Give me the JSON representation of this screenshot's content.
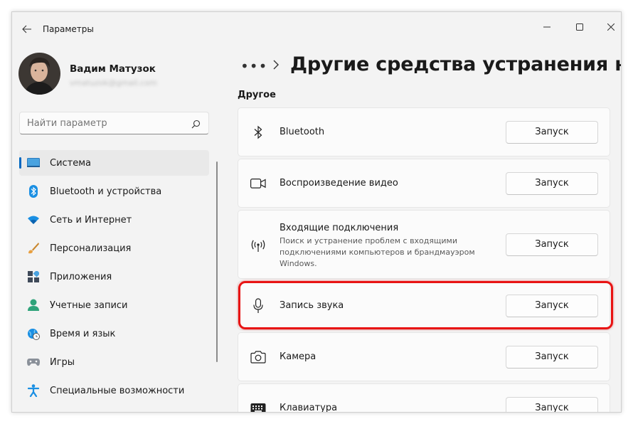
{
  "titlebar": {
    "app_title": "Параметры",
    "back_icon": "arrow-left-icon",
    "minimize_icon": "minimize-icon",
    "maximize_icon": "maximize-icon",
    "close_icon": "close-icon"
  },
  "profile": {
    "name": "Вадим Матузок",
    "email": "vmatuzok@gmail.com"
  },
  "search": {
    "placeholder": "Найти параметр",
    "icon": "search-icon"
  },
  "sidebar": {
    "items": [
      {
        "label": "Система",
        "icon": "system-icon",
        "active": true
      },
      {
        "label": "Bluetooth и устройства",
        "icon": "bluetooth-icon",
        "active": false
      },
      {
        "label": "Сеть и Интернет",
        "icon": "wifi-icon",
        "active": false
      },
      {
        "label": "Персонализация",
        "icon": "brush-icon",
        "active": false
      },
      {
        "label": "Приложения",
        "icon": "apps-icon",
        "active": false
      },
      {
        "label": "Учетные записи",
        "icon": "accounts-icon",
        "active": false
      },
      {
        "label": "Время и язык",
        "icon": "globe-clock-icon",
        "active": false
      },
      {
        "label": "Игры",
        "icon": "gamepad-icon",
        "active": false
      },
      {
        "label": "Специальные возможности",
        "icon": "accessibility-icon",
        "active": false
      }
    ]
  },
  "content": {
    "breadcrumb_more": "•••",
    "page_title": "Другие средства устранения непола",
    "section_title": "Другое",
    "items": [
      {
        "title": "Bluetooth",
        "icon": "bluetooth-icon",
        "button": "Запуск"
      },
      {
        "title": "Воспроизведение видео",
        "icon": "video-icon",
        "button": "Запуск"
      },
      {
        "title": "Входящие подключения",
        "description": "Поиск и устранение проблем с входящими подключениями компьютеров и брандмауэром Windows.",
        "icon": "incoming-connections-icon",
        "button": "Запуск"
      },
      {
        "title": "Запись звука",
        "icon": "microphone-icon",
        "button": "Запуск",
        "highlighted": true
      },
      {
        "title": "Камера",
        "icon": "camera-icon",
        "button": "Запуск"
      },
      {
        "title": "Клавиатура",
        "icon": "keyboard-icon",
        "button": "Запуск"
      }
    ]
  },
  "colors": {
    "accent": "#0067c0",
    "highlight": "#e81414"
  }
}
